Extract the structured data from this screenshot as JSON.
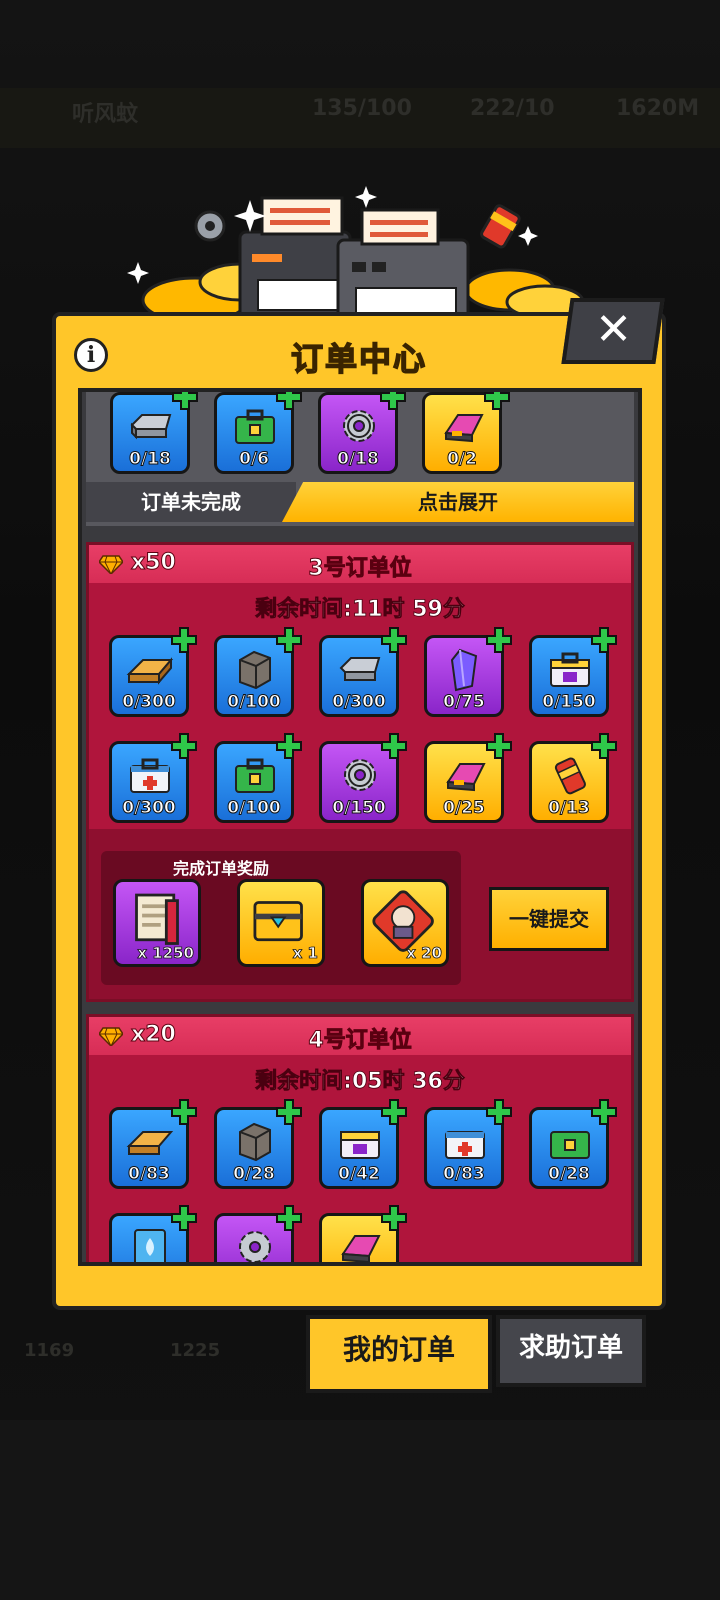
{
  "window": {
    "title": "订单中心"
  },
  "background": {
    "player_name": "听风蚊",
    "stat_1": "135/100",
    "stat_2": "222/10",
    "stat_3": "1620M",
    "bottom_counts": [
      "1169",
      "1225"
    ]
  },
  "modal": {
    "title": "订单中心",
    "info_label": "i",
    "close_label": "✕"
  },
  "order_top": {
    "items": [
      {
        "icon": "metal-ingot-icon",
        "qty": "0/18",
        "color": "blue"
      },
      {
        "icon": "green-toolbox-icon",
        "qty": "0/6",
        "color": "blue"
      },
      {
        "icon": "gear-icon",
        "qty": "0/18",
        "color": "purple"
      },
      {
        "icon": "pink-gadget-icon",
        "qty": "0/2",
        "color": "gold"
      }
    ],
    "status_label": "订单未完成",
    "expand_label": "点击展开"
  },
  "order_3": {
    "gem_reward": "x50",
    "title": "3号订单位",
    "timer": "剩余时间:11时 59分",
    "items": [
      {
        "icon": "wood-plank-icon",
        "qty": "0/300",
        "color": "blue"
      },
      {
        "icon": "stone-block-icon",
        "qty": "0/100",
        "color": "blue"
      },
      {
        "icon": "metal-ingot-icon",
        "qty": "0/300",
        "color": "blue"
      },
      {
        "icon": "purple-crystal-icon",
        "qty": "0/75",
        "color": "purple"
      },
      {
        "icon": "purple-toolbox-icon",
        "qty": "0/150",
        "color": "blue"
      },
      {
        "icon": "medkit-icon",
        "qty": "0/300",
        "color": "blue"
      },
      {
        "icon": "green-toolbox-icon",
        "qty": "0/100",
        "color": "blue"
      },
      {
        "icon": "gear-icon",
        "qty": "0/150",
        "color": "purple"
      },
      {
        "icon": "pink-gadget-icon",
        "qty": "0/25",
        "color": "gold"
      },
      {
        "icon": "red-canister-icon",
        "qty": "0/13",
        "color": "gold"
      }
    ],
    "reward_title": "完成订单奖励",
    "rewards": [
      {
        "icon": "blueprint-scroll-icon",
        "qty": "x 1250",
        "color": "purple"
      },
      {
        "icon": "treasure-chest-icon",
        "qty": "x 1",
        "color": "gold"
      },
      {
        "icon": "hero-puzzle-icon",
        "qty": "x 20",
        "color": "gold"
      }
    ],
    "submit_label": "一键提交"
  },
  "order_4": {
    "gem_reward": "x20",
    "title": "4号订单位",
    "timer": "剩余时间:05时 36分",
    "items": [
      {
        "icon": "wood-plank-icon",
        "qty": "0/83",
        "color": "blue"
      },
      {
        "icon": "stone-block-icon",
        "qty": "0/28",
        "color": "blue"
      },
      {
        "icon": "purple-toolbox-icon",
        "qty": "0/42",
        "color": "blue"
      },
      {
        "icon": "medkit-icon",
        "qty": "0/83",
        "color": "blue"
      },
      {
        "icon": "green-toolbox-icon",
        "qty": "0/28",
        "color": "blue"
      },
      {
        "icon": "water-card-icon",
        "qty": "",
        "color": "blue"
      },
      {
        "icon": "gear-icon",
        "qty": "",
        "color": "purple"
      },
      {
        "icon": "pink-gadget-icon",
        "qty": "",
        "color": "gold"
      }
    ]
  },
  "tabs": {
    "my_orders": "我的订单",
    "help_orders": "求助订单"
  },
  "colors": {
    "panel": "#ffc629",
    "order_bg": "#b0153c",
    "order_head": "#e83e66",
    "item_blue": "#2a8cf0",
    "item_purple": "#a83be0",
    "item_gold": "#ffc21a",
    "plus_green": "#2fc74a"
  }
}
